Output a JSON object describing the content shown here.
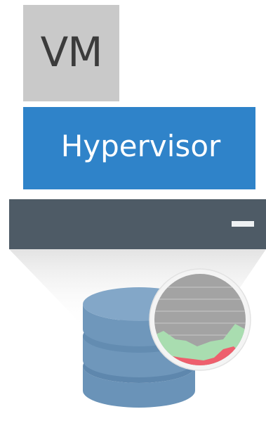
{
  "vm": {
    "label": "VM",
    "color": "#c9c9c9",
    "text_color": "#3b3b3b"
  },
  "hypervisor": {
    "label": "Hypervisor",
    "color": "#2f83c9",
    "text_color": "#ffffff"
  },
  "server": {
    "color": "#4e5b66",
    "indicator_color": "#eef1f3"
  },
  "icons": {
    "database": "database-icon",
    "monitor": "performance-chart-icon"
  },
  "colors": {
    "database": "#6f97bb",
    "chart_background": "#a3a3a3",
    "chart_green": "#a9ddb0",
    "chart_red": "#ee5f6d",
    "lens_ring": "#f4f4f4"
  }
}
